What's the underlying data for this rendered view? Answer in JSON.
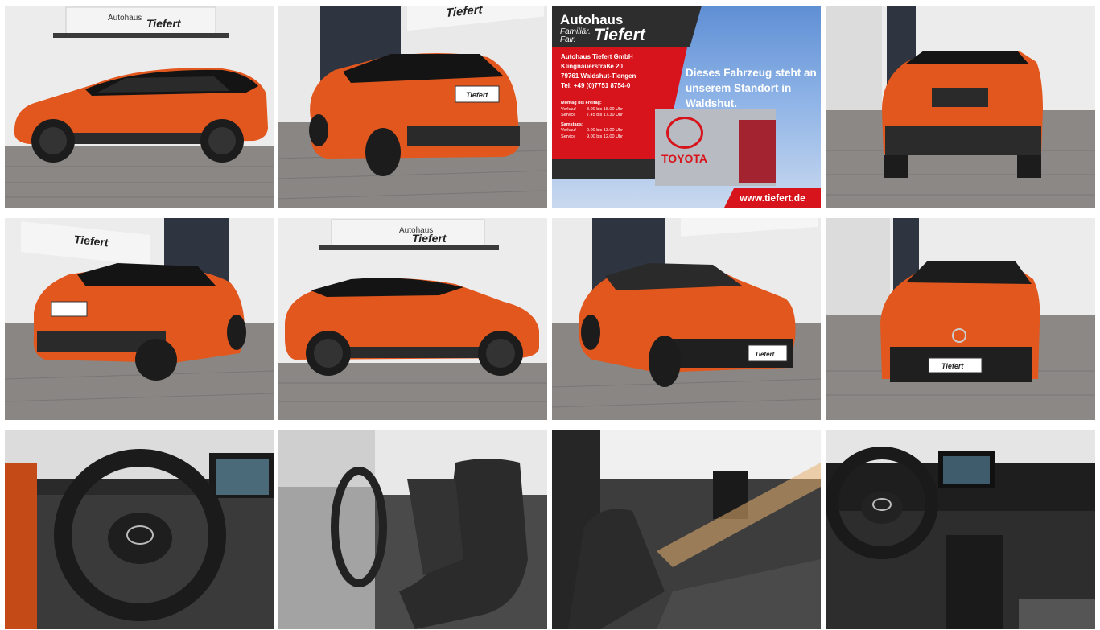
{
  "gallery": {
    "tiles": [
      {
        "id": "exterior-side-left"
      },
      {
        "id": "exterior-rear-left"
      },
      {
        "id": "dealer-promo"
      },
      {
        "id": "exterior-rear"
      },
      {
        "id": "exterior-rear-left-2"
      },
      {
        "id": "exterior-side-right"
      },
      {
        "id": "exterior-front-left"
      },
      {
        "id": "exterior-front"
      },
      {
        "id": "interior-steering-wheel"
      },
      {
        "id": "interior-front-seats"
      },
      {
        "id": "interior-passenger-side"
      },
      {
        "id": "interior-dashboard"
      }
    ]
  },
  "sign": {
    "brand": "Autohaus",
    "tagline_1": "Familiär.",
    "tagline_2": "Fair.",
    "name": "Tiefert"
  },
  "promo": {
    "company": "Autohaus Tiefert GmbH",
    "street": "Klingnauerstraße 20",
    "city": "79761 Waldshut-Tiengen",
    "phone": "Tel: +49 (0)7751 8754-0",
    "weekday_title": "Montag bis Freitag:",
    "weekday_sales_label": "Verkauf",
    "weekday_sales_hours": "8.00 bis 18.00 Uhr",
    "weekday_service_label": "Service",
    "weekday_service_hours": "7.45 bis 17.30 Uhr",
    "saturday_title": "Samstags:",
    "saturday_sales_label": "Verkauf",
    "saturday_sales_hours": "9.00 bis 13.00 Uhr",
    "saturday_service_label": "Service",
    "saturday_service_hours": "9.00 bis 12.00 Uhr",
    "claim": "Dieses Fahrzeug steht an unserem Standort in Waldshut.",
    "building_brand": "TOYOTA",
    "url": "www.tiefert.de"
  },
  "plate_text": "Tiefert",
  "colors": {
    "car_orange": "#e2571e",
    "car_roof": "#141414",
    "wall": "#ececec",
    "pavement": "#8b8784",
    "promo_red": "#d7141b",
    "promo_dark": "#2d2d2d"
  }
}
